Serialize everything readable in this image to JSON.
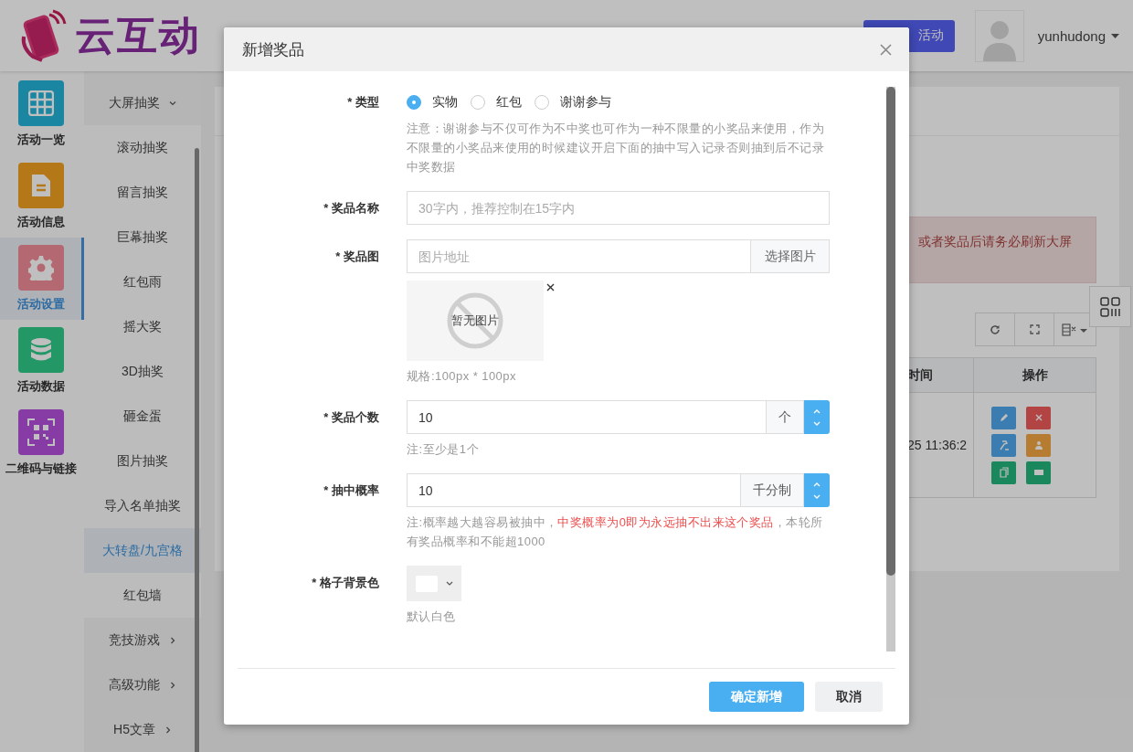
{
  "header": {
    "logo_text": "云互动",
    "action_button": "活动",
    "username": "yunhudong"
  },
  "sidebar": {
    "items": [
      {
        "label": "活动一览",
        "kind": "grid",
        "color": "#1a86a2",
        "selected": false
      },
      {
        "label": "活动信息",
        "kind": "document",
        "color": "#b47818",
        "selected": false
      },
      {
        "label": "活动设置",
        "kind": "gear",
        "color": "#b46972",
        "selected": true
      },
      {
        "label": "活动数据",
        "kind": "database",
        "color": "#239765",
        "selected": false
      },
      {
        "label": "二维码与链接",
        "kind": "qrcode",
        "color": "#863ba5",
        "selected": false
      }
    ]
  },
  "submenu": {
    "items": [
      {
        "label": "大屏抽奖",
        "expanded": true,
        "children": [
          {
            "label": "滚动抽奖",
            "selected": false
          },
          {
            "label": "留言抽奖",
            "selected": false
          },
          {
            "label": "巨幕抽奖",
            "selected": false
          },
          {
            "label": "红包雨",
            "selected": false
          },
          {
            "label": "摇大奖",
            "selected": false
          },
          {
            "label": "3D抽奖",
            "selected": false
          },
          {
            "label": "砸金蛋",
            "selected": false
          },
          {
            "label": "图片抽奖",
            "selected": false
          },
          {
            "label": "导入名单抽奖",
            "selected": false
          },
          {
            "label": "大转盘/九宫格",
            "selected": true
          },
          {
            "label": "红包墙",
            "selected": false
          }
        ]
      },
      {
        "label": "竞技游戏",
        "expanded": false
      },
      {
        "label": "高级功能",
        "expanded": false
      },
      {
        "label": "H5文章",
        "expanded": false
      }
    ]
  },
  "content": {
    "alert": "或者奖品后请务必刷新大屏",
    "toolbar": [
      {
        "kind": "refresh"
      },
      {
        "kind": "fullscreen"
      },
      {
        "kind": "columns"
      }
    ],
    "table": {
      "columns": [
        "时间",
        "操作"
      ],
      "rows": [
        {
          "cells": [
            "25 11:36:2"
          ],
          "actions": [
            {
              "kind": "edit",
              "color": "#3b7db0"
            },
            {
              "kind": "delete",
              "color": "#b34444"
            },
            {
              "kind": "hammer",
              "color": "#3b7db0"
            },
            {
              "kind": "person",
              "color": "#b67d32"
            },
            {
              "kind": "copy",
              "color": "#1a875d"
            },
            {
              "kind": "card",
              "color": "#1a875d"
            }
          ]
        }
      ]
    }
  },
  "modal": {
    "title": "新增奖品",
    "fields": [
      {
        "kind": "radio",
        "label": "* 类型",
        "options": [
          {
            "label": "实物",
            "selected": true
          },
          {
            "label": "红包",
            "selected": false
          },
          {
            "label": "谢谢参与",
            "selected": false
          }
        ],
        "note": [
          {
            "text": "注意：谢谢参与不仅可作为不中奖也可作为一种不限量的小奖品来使用，作为不限量的小奖品来使用的时候建议开启下面的抽中写入记录否则抽到后不记录中奖数据",
            "emphasis": false
          }
        ]
      },
      {
        "kind": "text",
        "label": "* 奖品名称",
        "placeholder": "30字内，推荐控制在15字内"
      },
      {
        "kind": "image",
        "label": "* 奖品图",
        "placeholder": "图片地址",
        "button": "选择图片",
        "preview_text": "暂无图片",
        "note": [
          {
            "text": "规格:100px * 100px",
            "emphasis": false
          }
        ]
      },
      {
        "kind": "number",
        "label": "* 奖品个数",
        "value": "10",
        "unit": "个",
        "note": [
          {
            "text": "注:至少是1个",
            "emphasis": false
          }
        ]
      },
      {
        "kind": "number",
        "label": "* 抽中概率",
        "value": "10",
        "unit": "千分制",
        "note": [
          {
            "text": "注:概率越大越容易被抽中，",
            "emphasis": false
          },
          {
            "text": "中奖概率为0即为永远抽不出来这个奖品",
            "emphasis": true
          },
          {
            "text": "，本轮所有奖品概率和不能超1000",
            "emphasis": false
          }
        ]
      },
      {
        "kind": "color",
        "label": "* 格子背景色",
        "color": "#ffffff",
        "note": [
          {
            "text": "默认白色",
            "emphasis": false
          }
        ]
      }
    ],
    "buttons": [
      {
        "label": "确定新增",
        "kind": "primary"
      },
      {
        "label": "取消",
        "kind": "default"
      }
    ]
  }
}
